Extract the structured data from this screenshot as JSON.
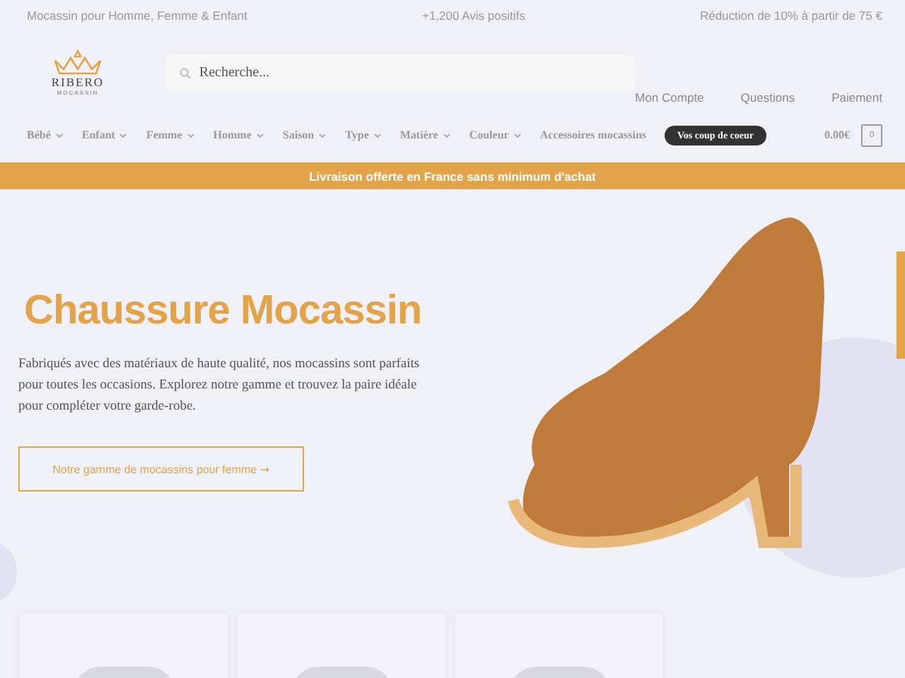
{
  "top_bar": [
    "Mocassin pour Homme, Femme & Enfant",
    "+1,200 Avis positifs",
    "Réduction de 10% à partir de 75 €"
  ],
  "logo": {
    "name": "RIBERO",
    "tagline": "MOCASSIN"
  },
  "search": {
    "placeholder": "Recherche..."
  },
  "header_links": [
    "Mon Compte",
    "Questions",
    "Paiement"
  ],
  "menu": [
    {
      "label": "Bébé",
      "kind": "dropdown"
    },
    {
      "label": "Enfant",
      "kind": "dropdown"
    },
    {
      "label": "Femme",
      "kind": "dropdown"
    },
    {
      "label": "Homme",
      "kind": "dropdown"
    },
    {
      "label": "Saison",
      "kind": "dropdown"
    },
    {
      "label": "Type",
      "kind": "dropdown"
    },
    {
      "label": "Matière",
      "kind": "dropdown"
    },
    {
      "label": "Couleur",
      "kind": "dropdown"
    },
    {
      "label": "Accessoires mocassins",
      "kind": "link"
    },
    {
      "label": "Vos coup de coeur",
      "kind": "pill"
    }
  ],
  "cart": {
    "total": "0.00€",
    "count": "0"
  },
  "banner": "Livraison offerte en France sans minimum d'achat",
  "hero": {
    "title": "Chaussure Mocassin",
    "text": "Fabriqués avec des matériaux de haute qualité, nos mocassins sont parfaits pour toutes les occasions. Explorez notre gamme et trouvez la paire idéale pour compléter votre garde-robe.",
    "button": "Notre gamme de mocassins pour femme ➞"
  }
}
